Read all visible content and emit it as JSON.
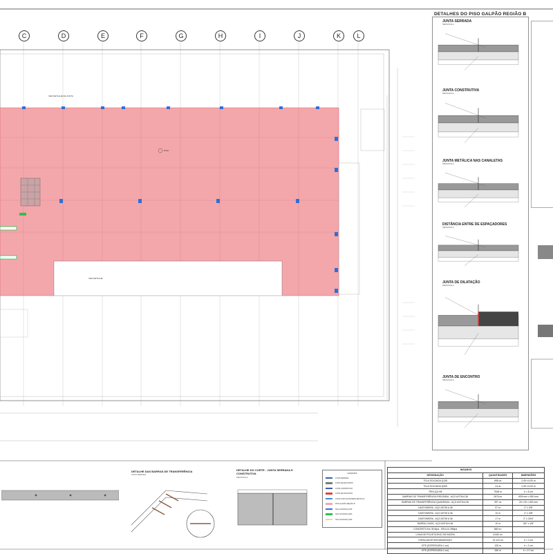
{
  "panel": {
    "title": "DETALHES DO PISO GALPÃO REGIÃO B",
    "details": [
      {
        "title": "JUNTA SERRADA",
        "sub": "SEM ESCALA"
      },
      {
        "title": "JUNTA CONSTRUTIVA",
        "sub": "SEM ESCALA"
      },
      {
        "title": "JUNTA METÁLICA NAS CANALETAS",
        "sub": "SEM ESCALA"
      },
      {
        "title": "DISTÂNCIA ENTRE DE ESPAÇADORES",
        "sub": "SEM ESCALA"
      },
      {
        "title": "JUNTA DE DILATAÇÃO",
        "sub": "SEM ESCALA"
      },
      {
        "title": "JUNTA DE ENCONTRO",
        "sub": "SEM ESCALA"
      }
    ]
  },
  "grid": {
    "labels": [
      "C",
      "D",
      "E",
      "F",
      "G",
      "H",
      "I",
      "J",
      "K",
      "L"
    ]
  },
  "plan": {
    "note1": "VER DETALHE DE JUNTA",
    "note2": "VER DETALHE",
    "legend_dilatacao": "JUNTA DE DILATAÇÃO"
  },
  "bottom": {
    "barras_title": "DETALHE DAS BARRAS DE TRANSFERÊNCIA",
    "barras_sub": "JUNTA SERRADA",
    "corte_title": "DETALHE DO CORTE - JUNTA SERRADA E CONSTRUTIVA",
    "corte_sub": "SEM ESCALA"
  },
  "legend": {
    "title": "LEGENDA",
    "items": [
      {
        "label": "JUNTA SERRADA",
        "color": "#3a5ea8"
      },
      {
        "label": "JUNTA DE ENCONTRO",
        "color": "#7a7a7a"
      },
      {
        "label": "JUNTA CONSTRUTIVA",
        "color": "#3a5ea8"
      },
      {
        "label": "JUNTA DE DILATAÇÃO",
        "color": "#e04040"
      },
      {
        "label": "JUNTA COM CANTONEIRA METÁLICA",
        "color": "#3d86d9"
      },
      {
        "label": "PISO GALPÃO REGIÃO B",
        "color": "#f4a7ab"
      },
      {
        "label": "TELA SOLDADA Q138",
        "color": "#2f6fd6"
      },
      {
        "label": "TELA SOLDADA Q283",
        "color": "#2fbf4f"
      },
      {
        "label": "TELA SOLDADA Q196",
        "color": "#f5d78e"
      }
    ]
  },
  "insumos": {
    "title": "INSUMOS",
    "headers": [
      "DESIGNAÇÃO",
      "QUANTIDADES",
      "DIMENSÕES"
    ],
    "rows": [
      [
        "TELA SOLDADA Q138",
        "658 un",
        "2,45 x 6,00 m"
      ],
      [
        "TELA SOLDADA Q283",
        "14 un",
        "2,45 x 6,00 m"
      ],
      [
        "TRELIÇA H8",
        "7948 m",
        "h = 8 cm"
      ],
      [
        "BARRAS DE TRANSFERÊNCIA REDONDA - AÇO ASTM A 36",
        "2676 un",
        "Ø25 mm x 500 mm"
      ],
      [
        "BARRAS DE TRANSFERÊNCIA QUADRADA - AÇO ASTM A 36",
        "397 un",
        "20 x 20 x 400 mm"
      ],
      [
        "CANTONEIRA - AÇO ASTM A 36",
        "57 m",
        "2\" x 3/8\""
      ],
      [
        "CANTONEIRA - AÇO ASTM A 36",
        "10 m",
        "2\" x 3/8\""
      ],
      [
        "CANTONEIRA - AÇO ASTM A 36",
        "17 m",
        "2\" x 3/16\""
      ],
      [
        "BARRA CHATA - AÇO ASTM A 36",
        "10 m",
        "3/4\" x 1/8\""
      ],
      [
        "CONCRETO fck 35 Mpa - SSt k14 25Mpa",
        "860 m³",
        "-"
      ],
      [
        "LONA DE POLIETILENO 200 MICRA",
        "8.060 m²",
        "-"
      ],
      [
        "ESPAÇADOR ARGAMASSADO",
        "22.124 un",
        "h = 2 cm"
      ],
      [
        "EPS (ESPESSURA 1 cm)",
        "125 m",
        "h = 2 cm"
      ],
      [
        "EPS (ESPESSURA 1 cm)",
        "260 m",
        "h = 17 cm"
      ]
    ]
  }
}
